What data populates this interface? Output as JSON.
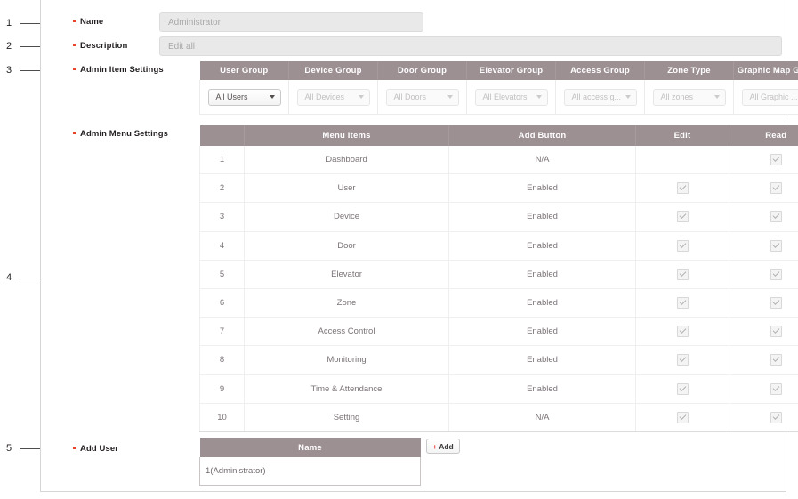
{
  "callouts": [
    {
      "number": "1",
      "label": "Name"
    },
    {
      "number": "2",
      "label": "Description"
    },
    {
      "number": "3",
      "label": "Admin Item Settings"
    },
    {
      "number": "4",
      "label": "Admin Menu Settings"
    },
    {
      "number": "5",
      "label": "Add User"
    }
  ],
  "fields": {
    "name": {
      "label": "Name",
      "value": "Administrator"
    },
    "description": {
      "label": "Description",
      "value": "Edit all"
    }
  },
  "item_settings": {
    "label": "Admin Item Settings",
    "columns": [
      "User Group",
      "Device Group",
      "Door Group",
      "Elevator Group",
      "Access Group",
      "Zone Type",
      "Graphic Map Group"
    ],
    "dropdowns": [
      {
        "value": "All Users",
        "disabled": false
      },
      {
        "value": "All Devices",
        "disabled": true
      },
      {
        "value": "All Doors",
        "disabled": true
      },
      {
        "value": "All Elevators",
        "disabled": true
      },
      {
        "value": "All access g...",
        "disabled": true
      },
      {
        "value": "All zones",
        "disabled": true
      },
      {
        "value": "All Graphic ...",
        "disabled": true
      }
    ]
  },
  "menu_settings": {
    "label": "Admin Menu Settings",
    "columns": [
      "",
      "Menu Items",
      "Add Button",
      "Edit",
      "Read"
    ],
    "rows": [
      {
        "index": "1",
        "menu_item": "Dashboard",
        "add_button": "N/A",
        "edit": false,
        "read": true
      },
      {
        "index": "2",
        "menu_item": "User",
        "add_button": "Enabled",
        "edit": true,
        "read": true
      },
      {
        "index": "3",
        "menu_item": "Device",
        "add_button": "Enabled",
        "edit": true,
        "read": true
      },
      {
        "index": "4",
        "menu_item": "Door",
        "add_button": "Enabled",
        "edit": true,
        "read": true
      },
      {
        "index": "5",
        "menu_item": "Elevator",
        "add_button": "Enabled",
        "edit": true,
        "read": true
      },
      {
        "index": "6",
        "menu_item": "Zone",
        "add_button": "Enabled",
        "edit": true,
        "read": true
      },
      {
        "index": "7",
        "menu_item": "Access Control",
        "add_button": "Enabled",
        "edit": true,
        "read": true
      },
      {
        "index": "8",
        "menu_item": "Monitoring",
        "add_button": "Enabled",
        "edit": true,
        "read": true
      },
      {
        "index": "9",
        "menu_item": "Time & Attendance",
        "add_button": "Enabled",
        "edit": true,
        "read": true
      },
      {
        "index": "10",
        "menu_item": "Setting",
        "add_button": "N/A",
        "edit": true,
        "read": true
      }
    ]
  },
  "add_user": {
    "label": "Add User",
    "column": "Name",
    "rows": [
      "1(Administrator)"
    ],
    "add_button": {
      "plus": "+",
      "label": "Add"
    }
  },
  "colors": {
    "header_mauve": "#9d9093",
    "bullet_red": "#e8442a",
    "input_bg": "#e9e9e9",
    "text_grey": "#7b7378"
  }
}
